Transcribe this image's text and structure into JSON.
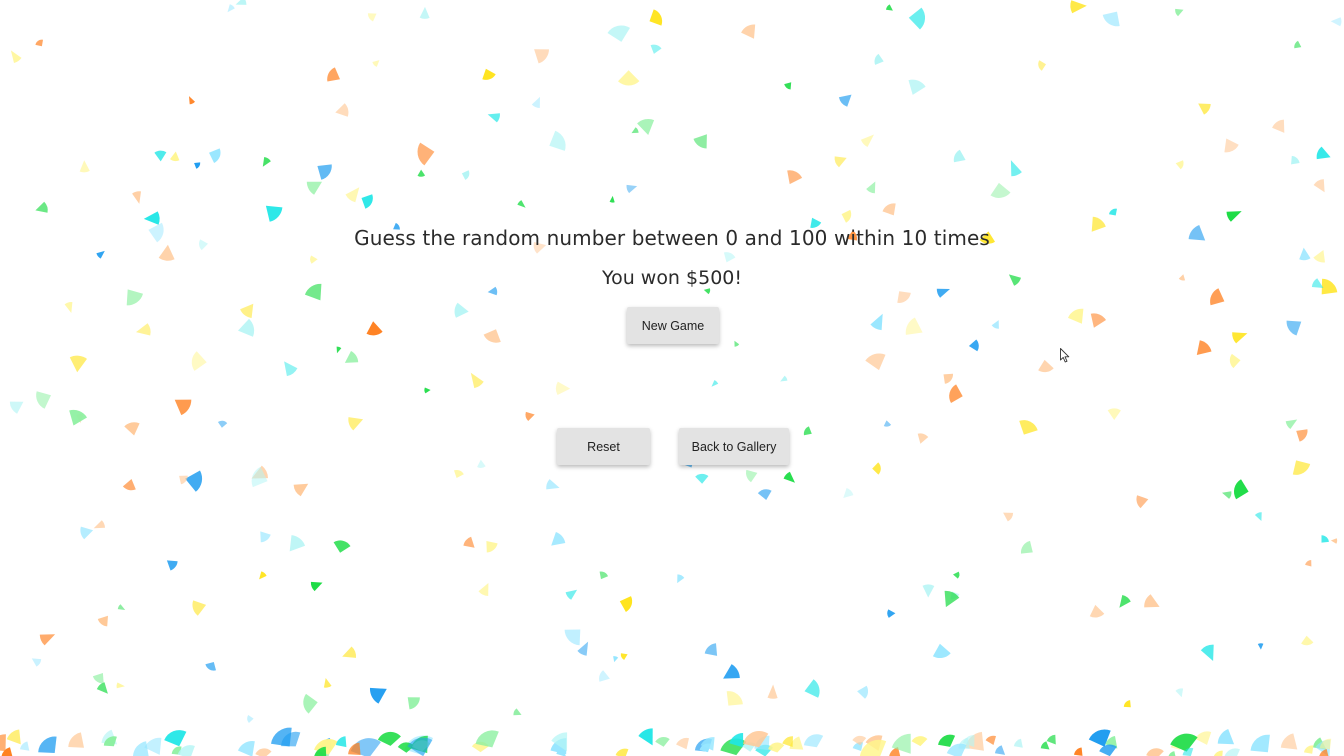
{
  "game": {
    "title": "Guess the random number between 0 and 100 within 10 times",
    "result_message": "You won $500!"
  },
  "buttons": {
    "new_game": "New Game",
    "reset": "Reset",
    "back_to_gallery": "Back to Gallery"
  },
  "confetti": {
    "colors": [
      "#ff7f1e",
      "#ffe41e",
      "#1ee6e6",
      "#1edc46",
      "#1e9cf0",
      "#ffc896",
      "#fff58c",
      "#8cf0a0",
      "#96e6ff",
      "#b4f5f5"
    ]
  }
}
